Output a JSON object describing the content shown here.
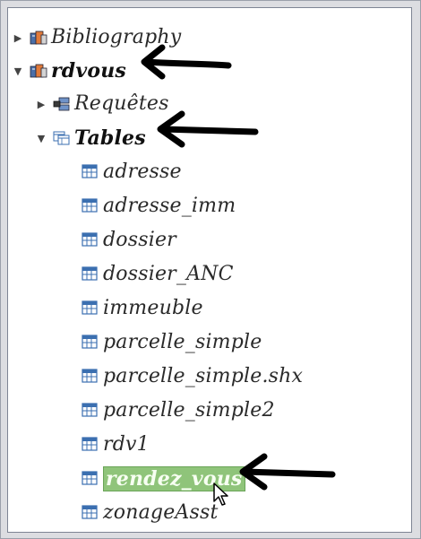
{
  "tree": {
    "nodes": [
      {
        "key": "bibliography",
        "label": "Bibliography",
        "level": 0,
        "expander": "▶",
        "icon": "database-icon",
        "bold": false,
        "selected": false
      },
      {
        "key": "rdvous",
        "label": "rdvous",
        "level": 0,
        "expander": "▼",
        "icon": "database-icon",
        "bold": true,
        "selected": false
      },
      {
        "key": "requetes",
        "label": "Requêtes",
        "level": 1,
        "expander": "▶",
        "icon": "queries-icon",
        "bold": false,
        "selected": false
      },
      {
        "key": "tables",
        "label": "Tables",
        "level": 1,
        "expander": "▼",
        "icon": "tables-folder-icon",
        "bold": true,
        "selected": false
      },
      {
        "key": "adresse",
        "label": "adresse",
        "level": 2,
        "icon": "table-icon"
      },
      {
        "key": "adresse_imm",
        "label": "adresse_imm",
        "level": 2,
        "icon": "table-icon"
      },
      {
        "key": "dossier",
        "label": "dossier",
        "level": 2,
        "icon": "table-icon"
      },
      {
        "key": "dossier_ANC",
        "label": "dossier_ANC",
        "level": 2,
        "icon": "table-icon"
      },
      {
        "key": "immeuble",
        "label": "immeuble",
        "level": 2,
        "icon": "table-icon"
      },
      {
        "key": "parcelle_simple",
        "label": "parcelle_simple",
        "level": 2,
        "icon": "table-icon"
      },
      {
        "key": "parcelle_simple_shx",
        "label": "parcelle_simple.shx",
        "level": 2,
        "icon": "table-icon"
      },
      {
        "key": "parcelle_simple2",
        "label": "parcelle_simple2",
        "level": 2,
        "icon": "table-icon"
      },
      {
        "key": "rdv1",
        "label": "rdv1",
        "level": 2,
        "icon": "table-icon"
      },
      {
        "key": "rendez_vous",
        "label": "rendez_vous",
        "level": 2,
        "icon": "table-icon",
        "selected": true
      },
      {
        "key": "zonageAsst",
        "label": "zonageAsst",
        "level": 2,
        "icon": "table-icon"
      }
    ]
  },
  "annotations": {
    "arrow_color": "#000000",
    "pointed_items": [
      "rdvous",
      "Tables",
      "rendez_vous"
    ]
  },
  "colors": {
    "selection_bg": "#8fc47a",
    "icon_blue": "#3b6fb0"
  }
}
